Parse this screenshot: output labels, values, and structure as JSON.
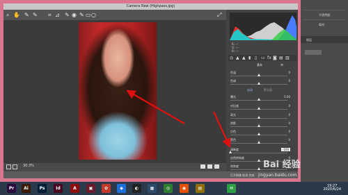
{
  "window": {
    "title": "Camera Raw (Highpass.jpg)"
  },
  "toolbar": {
    "tools": [
      {
        "name": "zoom-icon",
        "glyph": "⌕"
      },
      {
        "name": "hand-icon",
        "glyph": "✋"
      },
      {
        "name": "white-balance-icon",
        "glyph": "✎"
      },
      {
        "name": "color-sampler-icon",
        "glyph": "✎"
      },
      {
        "name": "crop-icon",
        "glyph": "⌗"
      },
      {
        "name": "straighten-icon",
        "glyph": "⊿"
      },
      {
        "name": "spot-removal-icon",
        "glyph": "✎"
      },
      {
        "name": "red-eye-icon",
        "glyph": "◉"
      },
      {
        "name": "brush-icon",
        "glyph": "✎"
      },
      {
        "name": "graduated-filter-icon",
        "glyph": "▭"
      },
      {
        "name": "radial-filter-icon",
        "glyph": "○"
      }
    ],
    "fullscreen_glyph": "⤢"
  },
  "histogram": {
    "labels": [
      "R:",
      "G:",
      "B:"
    ],
    "values": [
      "---",
      "---",
      "---"
    ]
  },
  "panel": {
    "section_title": "基本",
    "wb_mode": "自动",
    "tone_mode": "默认值",
    "sliders": [
      {
        "label": "色温",
        "value": "0",
        "level": 0.5
      },
      {
        "label": "色调",
        "value": "0",
        "level": 0.5
      },
      {
        "label": "曝光",
        "value": "0.00",
        "level": 0.5
      },
      {
        "label": "对比度",
        "value": "0",
        "level": 0.5
      },
      {
        "label": "高光",
        "value": "0",
        "level": 0.5
      },
      {
        "label": "阴影",
        "value": "0",
        "level": 0.5
      },
      {
        "label": "白色",
        "value": "0",
        "level": 0.5
      },
      {
        "label": "黑色",
        "value": "0",
        "level": 0.5
      },
      {
        "label": "清晰度",
        "value": "-100",
        "level": 0.0,
        "highlighted": true
      },
      {
        "label": "自然饱和度",
        "value": "0",
        "level": 0.5
      },
      {
        "label": "饱和度",
        "value": "0",
        "level": 0.5
      }
    ],
    "buttons": "打开图像  取消  完成"
  },
  "bottom": {
    "zoom": "30.3%"
  },
  "photoshop": {
    "right_labels": [
      "不透明度:",
      "填充:",
      "图层"
    ]
  },
  "taskbar": {
    "icons": [
      {
        "name": "premiere-icon",
        "label": "Pr",
        "color": "#2a0a3d"
      },
      {
        "name": "illustrator-icon",
        "label": "Ai",
        "color": "#3a1a00"
      },
      {
        "name": "photoshop-icon",
        "label": "Ps",
        "color": "#001e36"
      },
      {
        "name": "indesign-icon",
        "label": "Id",
        "color": "#49021f"
      },
      {
        "name": "acrobat-icon",
        "label": "A",
        "color": "#8e0c0c"
      },
      {
        "name": "media-icon",
        "label": "▣",
        "color": "#6a1a2a"
      },
      {
        "name": "app-red-icon",
        "label": "✿",
        "color": "#c0392b"
      },
      {
        "name": "app-blue-icon",
        "label": "◆",
        "color": "#1e6fd9"
      },
      {
        "name": "qq-icon",
        "label": "◐",
        "color": "#222"
      },
      {
        "name": "app-grid-icon",
        "label": "▦",
        "color": "#2d4b6b"
      },
      {
        "name": "chrome-icon",
        "label": "◎",
        "color": "#2e7d32"
      },
      {
        "name": "firefox-icon",
        "label": "◉",
        "color": "#e65100"
      },
      {
        "name": "files-icon",
        "label": "▤",
        "color": "#8d6e00"
      },
      {
        "name": "wechat-icon",
        "label": "✉",
        "color": "#2e9e46"
      }
    ],
    "time": "19:27",
    "date": "2020/6/24"
  },
  "watermark": {
    "brand": "Bai 经验",
    "url": "jingyan.baidu.com"
  }
}
